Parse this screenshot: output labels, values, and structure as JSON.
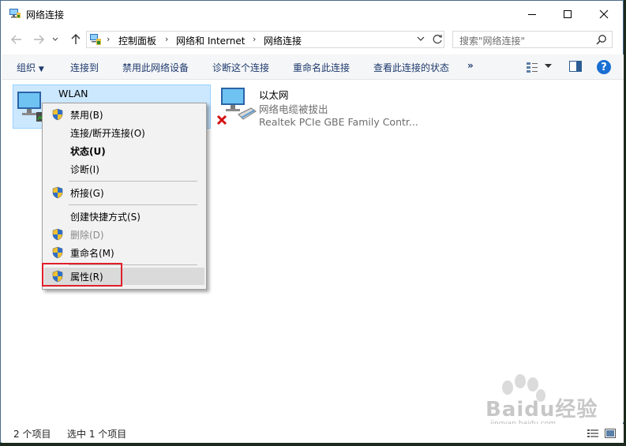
{
  "window": {
    "title": "网络连接",
    "icon": "network-connections-icon",
    "controls": [
      "minimize-icon",
      "maximize-icon",
      "close-icon"
    ]
  },
  "address": {
    "breadcrumbs": [
      "控制面板",
      "网络和 Internet",
      "网络连接"
    ],
    "search_placeholder": "搜索\"网络连接\""
  },
  "commandbar": {
    "organize": "组织",
    "items": [
      "连接到",
      "禁用此网络设备",
      "诊断这个连接",
      "重命名此连接",
      "查看此连接的状态"
    ],
    "more": "»",
    "help": "?"
  },
  "items": [
    {
      "name": "WLAN",
      "status": "",
      "adapter": "",
      "selected": true
    },
    {
      "name": "以太网",
      "status": "网络电缆被拔出",
      "adapter": "Realtek PCIe GBE Family Contr..."
    }
  ],
  "context_menu": {
    "items": [
      {
        "label": "禁用(B)",
        "shield": true
      },
      {
        "label": "连接/断开连接(O)",
        "shield": false
      },
      {
        "label": "状态(U)",
        "shield": false,
        "bold": true
      },
      {
        "label": "诊断(I)",
        "shield": false
      },
      {
        "label": "桥接(G)",
        "shield": true
      },
      {
        "label": "创建快捷方式(S)",
        "shield": false
      },
      {
        "label": "删除(D)",
        "shield": true,
        "disabled": true
      },
      {
        "label": "重命名(M)",
        "shield": true
      },
      {
        "label": "属性(R)",
        "shield": true,
        "highlighted": true
      }
    ]
  },
  "statusbar": {
    "count": "2 个项目",
    "selection": "选中 1 个项目"
  },
  "watermark": {
    "text": "Baidu经验",
    "sub": "jingyan.baidu.com"
  },
  "colors": {
    "accent": "#1a6fd3",
    "selection": "#cce8ff",
    "highlight_box": "#e01e2a"
  }
}
